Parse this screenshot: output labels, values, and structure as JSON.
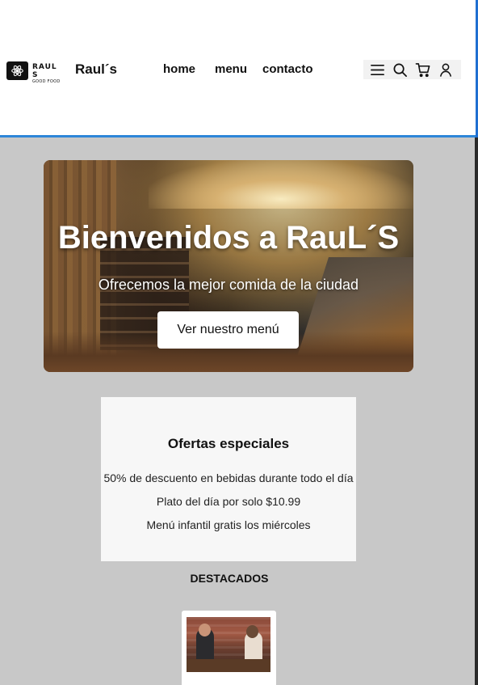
{
  "header": {
    "logo_line1": "RAUL S",
    "logo_line2": "GOOD FOOD",
    "brand": "Raul´s",
    "nav": [
      {
        "label": "home"
      },
      {
        "label": "menu"
      },
      {
        "label": "contacto"
      }
    ],
    "icons": [
      "menu-icon",
      "search-icon",
      "cart-icon",
      "user-icon"
    ]
  },
  "hero": {
    "title": "Bienvenidos a RauL´S",
    "subtitle": "Ofrecemos la mejor comida de la ciudad",
    "button_label": "Ver nuestro menú"
  },
  "offers": {
    "title": "Ofertas especiales",
    "items": [
      "50% de descuento en bebidas durante todo el día",
      "Plato del día por solo $10.99",
      "Menú infantil gratis los miércoles"
    ]
  },
  "featured": {
    "title": "DESTACADOS"
  },
  "colors": {
    "page_bg": "#c8c8c8",
    "header_border": "#2d86d8",
    "card_bg": "#f7f7f7"
  }
}
